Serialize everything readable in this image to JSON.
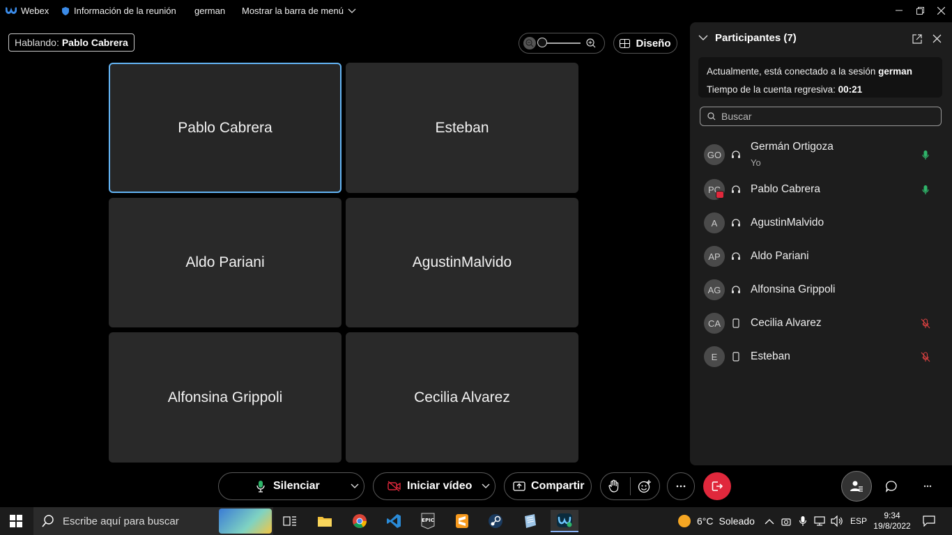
{
  "titlebar": {
    "app_name": "Webex",
    "meeting_info": "Información de la reunión",
    "user": "german",
    "menu_toggle": "Mostrar la barra de menú"
  },
  "speaking": {
    "label": "Hablando:",
    "name": "Pablo Cabrera"
  },
  "toolbar": {
    "layout_label": "Diseño"
  },
  "tiles": [
    {
      "name": "Pablo Cabrera",
      "active": true
    },
    {
      "name": "Esteban"
    },
    {
      "name": "Aldo Pariani"
    },
    {
      "name": "AgustinMalvido"
    },
    {
      "name": "Alfonsina Grippoli"
    },
    {
      "name": "Cecilia Alvarez"
    }
  ],
  "panel": {
    "title": "Participantes (7)",
    "session_text": "Actualmente, está conectado a la sesión",
    "session_name": "german",
    "countdown_label": "Tiempo de la cuenta regresiva:",
    "countdown_value": "00:21",
    "search_placeholder": "Buscar",
    "participants": [
      {
        "initials": "GO",
        "name": "Germán Ortigoza",
        "sub": "Yo",
        "device": "headset-icon",
        "mic": "unmuted"
      },
      {
        "initials": "PC",
        "name": "Pablo Cabrera",
        "device": "headset-icon",
        "mic": "unmuted"
      },
      {
        "initials": "A",
        "name": "AgustinMalvido",
        "device": "headset-icon",
        "mic": "none"
      },
      {
        "initials": "AP",
        "name": "Aldo Pariani",
        "device": "headset-icon",
        "mic": "none"
      },
      {
        "initials": "AG",
        "name": "Alfonsina Grippoli",
        "device": "headset-icon",
        "mic": "none"
      },
      {
        "initials": "CA",
        "name": "Cecilia Alvarez",
        "device": "mobile-icon",
        "mic": "muted"
      },
      {
        "initials": "E",
        "name": "Esteban",
        "device": "mobile-icon",
        "mic": "muted"
      }
    ]
  },
  "controls": {
    "mute_label": "Silenciar",
    "video_label": "Iniciar vídeo",
    "share_label": "Compartir"
  },
  "taskbar": {
    "search_placeholder": "Escribe aquí para buscar",
    "weather_temp": "6°C",
    "weather_desc": "Soleado",
    "language": "ESP",
    "time": "9:34",
    "date": "19/8/2022"
  },
  "colors": {
    "accent_blue": "#64b5f6",
    "leave_red": "#e0283c",
    "mic_green": "#2fb56a",
    "mic_muted_red": "#d94040"
  }
}
